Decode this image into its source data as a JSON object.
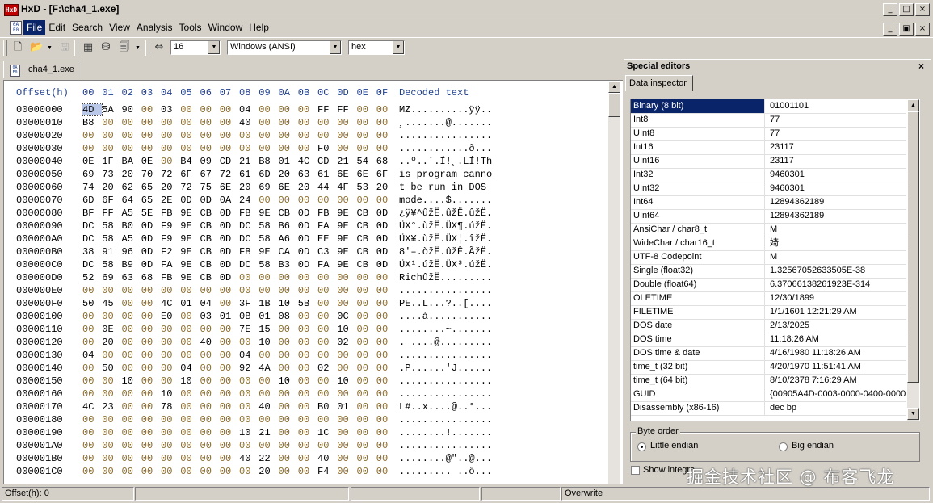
{
  "window": {
    "title": "HxD - [F:\\cha4_1.exe]",
    "app_icon_text": "HxD"
  },
  "menu": [
    "File",
    "Edit",
    "Search",
    "View",
    "Analysis",
    "Tools",
    "Window",
    "Help"
  ],
  "toolbar": {
    "bytes_per_row": "16",
    "charset": "Windows (ANSI)",
    "offset_base": "hex"
  },
  "document_tab": "cha4_1.exe",
  "hex_header": {
    "offset_label": "Offset(h)",
    "columns": [
      "00",
      "01",
      "02",
      "03",
      "04",
      "05",
      "06",
      "07",
      "08",
      "09",
      "0A",
      "0B",
      "0C",
      "0D",
      "0E",
      "0F"
    ],
    "decoded_label": "Decoded text"
  },
  "rows": [
    {
      "offset": "00000000",
      "bytes": [
        "4D",
        "5A",
        "90",
        "00",
        "03",
        "00",
        "00",
        "00",
        "04",
        "00",
        "00",
        "00",
        "FF",
        "FF",
        "00",
        "00"
      ],
      "text": "MZ..........ÿÿ.."
    },
    {
      "offset": "00000010",
      "bytes": [
        "B8",
        "00",
        "00",
        "00",
        "00",
        "00",
        "00",
        "00",
        "40",
        "00",
        "00",
        "00",
        "00",
        "00",
        "00",
        "00"
      ],
      "text": "¸.......@......."
    },
    {
      "offset": "00000020",
      "bytes": [
        "00",
        "00",
        "00",
        "00",
        "00",
        "00",
        "00",
        "00",
        "00",
        "00",
        "00",
        "00",
        "00",
        "00",
        "00",
        "00"
      ],
      "text": "................"
    },
    {
      "offset": "00000030",
      "bytes": [
        "00",
        "00",
        "00",
        "00",
        "00",
        "00",
        "00",
        "00",
        "00",
        "00",
        "00",
        "00",
        "F0",
        "00",
        "00",
        "00"
      ],
      "text": "............ð..."
    },
    {
      "offset": "00000040",
      "bytes": [
        "0E",
        "1F",
        "BA",
        "0E",
        "00",
        "B4",
        "09",
        "CD",
        "21",
        "B8",
        "01",
        "4C",
        "CD",
        "21",
        "54",
        "68"
      ],
      "text": "..º..´.Í!¸.LÍ!Th"
    },
    {
      "offset": "00000050",
      "bytes": [
        "69",
        "73",
        "20",
        "70",
        "72",
        "6F",
        "67",
        "72",
        "61",
        "6D",
        "20",
        "63",
        "61",
        "6E",
        "6E",
        "6F"
      ],
      "text": "is program canno"
    },
    {
      "offset": "00000060",
      "bytes": [
        "74",
        "20",
        "62",
        "65",
        "20",
        "72",
        "75",
        "6E",
        "20",
        "69",
        "6E",
        "20",
        "44",
        "4F",
        "53",
        "20"
      ],
      "text": "t be run in DOS "
    },
    {
      "offset": "00000070",
      "bytes": [
        "6D",
        "6F",
        "64",
        "65",
        "2E",
        "0D",
        "0D",
        "0A",
        "24",
        "00",
        "00",
        "00",
        "00",
        "00",
        "00",
        "00"
      ],
      "text": "mode....$......."
    },
    {
      "offset": "00000080",
      "bytes": [
        "BF",
        "FF",
        "A5",
        "5E",
        "FB",
        "9E",
        "CB",
        "0D",
        "FB",
        "9E",
        "CB",
        "0D",
        "FB",
        "9E",
        "CB",
        "0D"
      ],
      "text": "¿ÿ¥^ûžË.ûžË.ûžË."
    },
    {
      "offset": "00000090",
      "bytes": [
        "DC",
        "58",
        "B0",
        "0D",
        "F9",
        "9E",
        "CB",
        "0D",
        "DC",
        "58",
        "B6",
        "0D",
        "FA",
        "9E",
        "CB",
        "0D"
      ],
      "text": "ÜX°.ùžË.ÜX¶.úžË."
    },
    {
      "offset": "000000A0",
      "bytes": [
        "DC",
        "58",
        "A5",
        "0D",
        "F9",
        "9E",
        "CB",
        "0D",
        "DC",
        "58",
        "A6",
        "0D",
        "EE",
        "9E",
        "CB",
        "0D"
      ],
      "text": "ÜX¥.ùžË.ÜX¦.îžË."
    },
    {
      "offset": "000000B0",
      "bytes": [
        "38",
        "91",
        "96",
        "0D",
        "F2",
        "9E",
        "CB",
        "0D",
        "FB",
        "9E",
        "CA",
        "0D",
        "C3",
        "9E",
        "CB",
        "0D"
      ],
      "text": "8'–.òžË.ûžÊ.ÃžË."
    },
    {
      "offset": "000000C0",
      "bytes": [
        "DC",
        "58",
        "B9",
        "0D",
        "FA",
        "9E",
        "CB",
        "0D",
        "DC",
        "58",
        "B3",
        "0D",
        "FA",
        "9E",
        "CB",
        "0D"
      ],
      "text": "ÜX¹.úžË.ÜX³.úžË."
    },
    {
      "offset": "000000D0",
      "bytes": [
        "52",
        "69",
        "63",
        "68",
        "FB",
        "9E",
        "CB",
        "0D",
        "00",
        "00",
        "00",
        "00",
        "00",
        "00",
        "00",
        "00"
      ],
      "text": "RichûžË........."
    },
    {
      "offset": "000000E0",
      "bytes": [
        "00",
        "00",
        "00",
        "00",
        "00",
        "00",
        "00",
        "00",
        "00",
        "00",
        "00",
        "00",
        "00",
        "00",
        "00",
        "00"
      ],
      "text": "................"
    },
    {
      "offset": "000000F0",
      "bytes": [
        "50",
        "45",
        "00",
        "00",
        "4C",
        "01",
        "04",
        "00",
        "3F",
        "1B",
        "10",
        "5B",
        "00",
        "00",
        "00",
        "00"
      ],
      "text": "PE..L...?..[...."
    },
    {
      "offset": "00000100",
      "bytes": [
        "00",
        "00",
        "00",
        "00",
        "E0",
        "00",
        "03",
        "01",
        "0B",
        "01",
        "08",
        "00",
        "00",
        "0C",
        "00",
        "00"
      ],
      "text": "....à..........."
    },
    {
      "offset": "00000110",
      "bytes": [
        "00",
        "0E",
        "00",
        "00",
        "00",
        "00",
        "00",
        "00",
        "7E",
        "15",
        "00",
        "00",
        "00",
        "10",
        "00",
        "00"
      ],
      "text": "........~......."
    },
    {
      "offset": "00000120",
      "bytes": [
        "00",
        "20",
        "00",
        "00",
        "00",
        "00",
        "40",
        "00",
        "00",
        "10",
        "00",
        "00",
        "00",
        "02",
        "00",
        "00"
      ],
      "text": ". ....@........."
    },
    {
      "offset": "00000130",
      "bytes": [
        "04",
        "00",
        "00",
        "00",
        "00",
        "00",
        "00",
        "00",
        "04",
        "00",
        "00",
        "00",
        "00",
        "00",
        "00",
        "00"
      ],
      "text": "................"
    },
    {
      "offset": "00000140",
      "bytes": [
        "00",
        "50",
        "00",
        "00",
        "00",
        "04",
        "00",
        "00",
        "92",
        "4A",
        "00",
        "00",
        "02",
        "00",
        "00",
        "00"
      ],
      "text": ".P......'J......"
    },
    {
      "offset": "00000150",
      "bytes": [
        "00",
        "00",
        "10",
        "00",
        "00",
        "10",
        "00",
        "00",
        "00",
        "00",
        "10",
        "00",
        "00",
        "10",
        "00",
        "00"
      ],
      "text": "................"
    },
    {
      "offset": "00000160",
      "bytes": [
        "00",
        "00",
        "00",
        "00",
        "10",
        "00",
        "00",
        "00",
        "00",
        "00",
        "00",
        "00",
        "00",
        "00",
        "00",
        "00"
      ],
      "text": "................"
    },
    {
      "offset": "00000170",
      "bytes": [
        "4C",
        "23",
        "00",
        "00",
        "78",
        "00",
        "00",
        "00",
        "00",
        "40",
        "00",
        "00",
        "B0",
        "01",
        "00",
        "00"
      ],
      "text": "L#..x....@..°..."
    },
    {
      "offset": "00000180",
      "bytes": [
        "00",
        "00",
        "00",
        "00",
        "00",
        "00",
        "00",
        "00",
        "00",
        "00",
        "00",
        "00",
        "00",
        "00",
        "00",
        "00"
      ],
      "text": "................"
    },
    {
      "offset": "00000190",
      "bytes": [
        "00",
        "00",
        "00",
        "00",
        "00",
        "00",
        "00",
        "00",
        "10",
        "21",
        "00",
        "00",
        "1C",
        "00",
        "00",
        "00"
      ],
      "text": "........!......."
    },
    {
      "offset": "000001A0",
      "bytes": [
        "00",
        "00",
        "00",
        "00",
        "00",
        "00",
        "00",
        "00",
        "00",
        "00",
        "00",
        "00",
        "00",
        "00",
        "00",
        "00"
      ],
      "text": "................"
    },
    {
      "offset": "000001B0",
      "bytes": [
        "00",
        "00",
        "00",
        "00",
        "00",
        "00",
        "00",
        "00",
        "40",
        "22",
        "00",
        "00",
        "40",
        "00",
        "00",
        "00"
      ],
      "text": "........@\"..@..."
    },
    {
      "offset": "000001C0",
      "bytes": [
        "00",
        "00",
        "00",
        "00",
        "00",
        "00",
        "00",
        "00",
        "00",
        "20",
        "00",
        "00",
        "F4",
        "00",
        "00",
        "00"
      ],
      "text": "......... ..ô..."
    }
  ],
  "special_editors": {
    "title": "Special editors",
    "close": "×",
    "tab": "Data inspector",
    "fields": [
      {
        "name": "Binary (8 bit)",
        "value": "01001101"
      },
      {
        "name": "Int8",
        "value": "77"
      },
      {
        "name": "UInt8",
        "value": "77"
      },
      {
        "name": "Int16",
        "value": "23117"
      },
      {
        "name": "UInt16",
        "value": "23117"
      },
      {
        "name": "Int32",
        "value": "9460301"
      },
      {
        "name": "UInt32",
        "value": "9460301"
      },
      {
        "name": "Int64",
        "value": "12894362189"
      },
      {
        "name": "UInt64",
        "value": "12894362189"
      },
      {
        "name": "AnsiChar / char8_t",
        "value": "M"
      },
      {
        "name": "WideChar / char16_t",
        "value": "婍"
      },
      {
        "name": "UTF-8 Codepoint",
        "value": "M"
      },
      {
        "name": "Single (float32)",
        "value": "1.32567052633505E-38"
      },
      {
        "name": "Double (float64)",
        "value": "6.37066138261923E-314"
      },
      {
        "name": "OLETIME",
        "value": "12/30/1899"
      },
      {
        "name": "FILETIME",
        "value": "1/1/1601 12:21:29 AM"
      },
      {
        "name": "DOS date",
        "value": "2/13/2025"
      },
      {
        "name": "DOS time",
        "value": "11:18:26 AM"
      },
      {
        "name": "DOS time & date",
        "value": "4/16/1980 11:18:26 AM"
      },
      {
        "name": "time_t (32 bit)",
        "value": "4/20/1970 11:51:41 AM"
      },
      {
        "name": "time_t (64 bit)",
        "value": "8/10/2378 7:16:29 AM"
      },
      {
        "name": "GUID",
        "value": "{00905A4D-0003-0000-0400-0000"
      },
      {
        "name": "Disassembly (x86-16)",
        "value": "dec bp"
      }
    ],
    "byte_order": {
      "legend": "Byte order",
      "little": "Little endian",
      "big": "Big endian",
      "selected": "little"
    },
    "show_integral": "Show integral"
  },
  "status": {
    "offset": "Offset(h): 0",
    "mode": "Overwrite"
  },
  "watermark": "掘金技术社区 @ 布客飞龙"
}
